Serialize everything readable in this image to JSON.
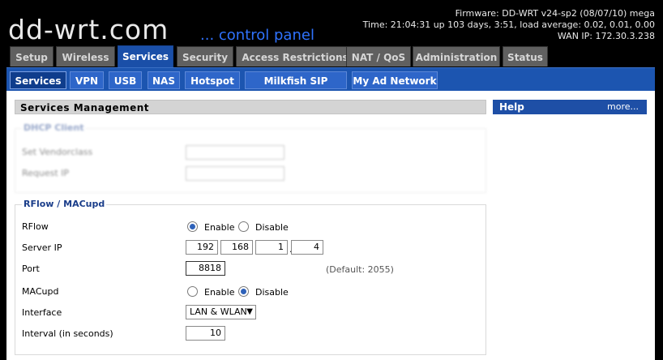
{
  "header": {
    "logo": "dd-wrt.com",
    "tagline": "... control panel",
    "firmware": "Firmware: DD-WRT v24-sp2 (08/07/10) mega",
    "time": "Time: 21:04:31 up 103 days, 3:51, load average: 0.02, 0.01, 0.00",
    "wan_ip": "WAN IP: 172.30.3.238"
  },
  "main_tabs": [
    "Setup",
    "Wireless",
    "Services",
    "Security",
    "Access Restrictions",
    "NAT / QoS",
    "Administration",
    "Status"
  ],
  "sub_tabs": [
    "Services",
    "VPN",
    "USB",
    "NAS",
    "Hotspot",
    "Milkfish SIP Router",
    "My Ad Network"
  ],
  "section_title": "Services Management",
  "dhcp": {
    "legend": "DHCP Client",
    "vendorclass_label": "Set Vendorclass",
    "requestip_label": "Request IP"
  },
  "rflow": {
    "legend": "RFlow / MACupd",
    "rflow_label": "RFlow",
    "enable_label": "Enable",
    "disable_label": "Disable",
    "server_ip_label": "Server IP",
    "server_ip": [
      "192",
      "168",
      "1",
      "4"
    ],
    "port_label": "Port",
    "port_value": "8818",
    "port_default": "(Default: 2055)",
    "macupd_label": "MACupd",
    "interface_label": "Interface",
    "interface_value": "LAN & WLAN",
    "interval_label": "Interval (in seconds)",
    "interval_value": "10",
    "rflow_enabled": true,
    "macupd_enabled": false
  },
  "help": {
    "title": "Help",
    "more": "more..."
  },
  "colors": {
    "accent": "#1c55b0",
    "tab_bg": "#606060"
  }
}
